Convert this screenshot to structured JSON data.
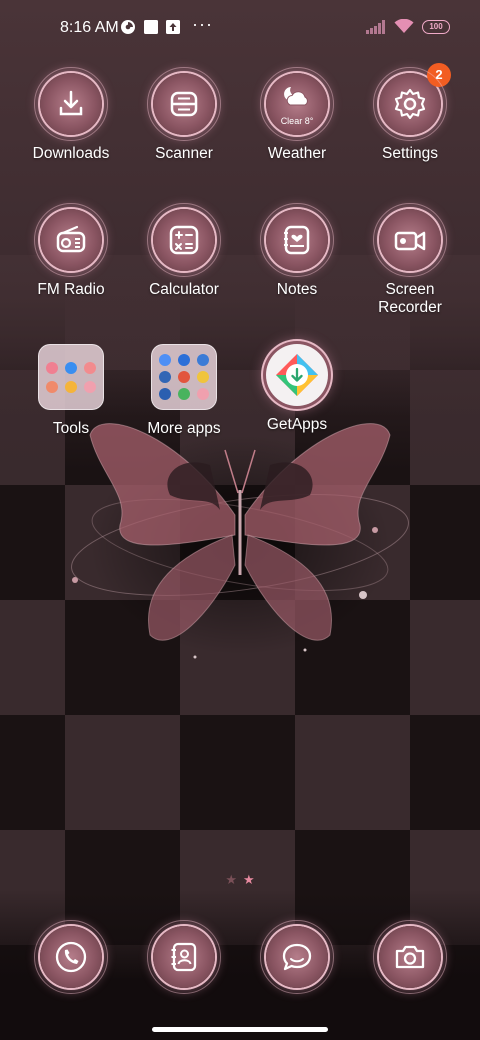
{
  "status_bar": {
    "time": "8:16 AM",
    "battery": "100",
    "overflow": "···",
    "icons": [
      "data-saver-icon",
      "square-notification-icon",
      "upload-notification-icon",
      "signal-icon",
      "wifi-icon",
      "battery-icon"
    ]
  },
  "apps": [
    {
      "label": "Downloads",
      "icon": "download-icon"
    },
    {
      "label": "Scanner",
      "icon": "scanner-icon"
    },
    {
      "label": "Weather",
      "icon": "weather-icon",
      "widget_text": "Clear 8°"
    },
    {
      "label": "Settings",
      "icon": "gear-icon",
      "badge": "2"
    },
    {
      "label": "FM Radio",
      "icon": "radio-icon"
    },
    {
      "label": "Calculator",
      "icon": "calculator-icon"
    },
    {
      "label": "Notes",
      "icon": "notes-icon"
    },
    {
      "label": "Screen\nRecorder",
      "icon": "video-camera-icon"
    },
    {
      "label": "Tools",
      "icon": "folder-icon"
    },
    {
      "label": "More apps",
      "icon": "folder-icon"
    },
    {
      "label": "GetApps",
      "icon": "getapps-icon"
    }
  ],
  "dock": [
    {
      "name": "phone",
      "icon": "phone-icon"
    },
    {
      "name": "contacts",
      "icon": "contacts-icon"
    },
    {
      "name": "messages",
      "icon": "message-icon"
    },
    {
      "name": "camera",
      "icon": "camera-icon"
    }
  ],
  "pager": {
    "pages": 2,
    "current": 2,
    "glyph": "★"
  },
  "colors": {
    "accent_pink": "#e6b9c5",
    "badge": "#f25d22",
    "wallpaper_dark": "#1a1213",
    "wallpaper_light": "#3a2b2e"
  }
}
